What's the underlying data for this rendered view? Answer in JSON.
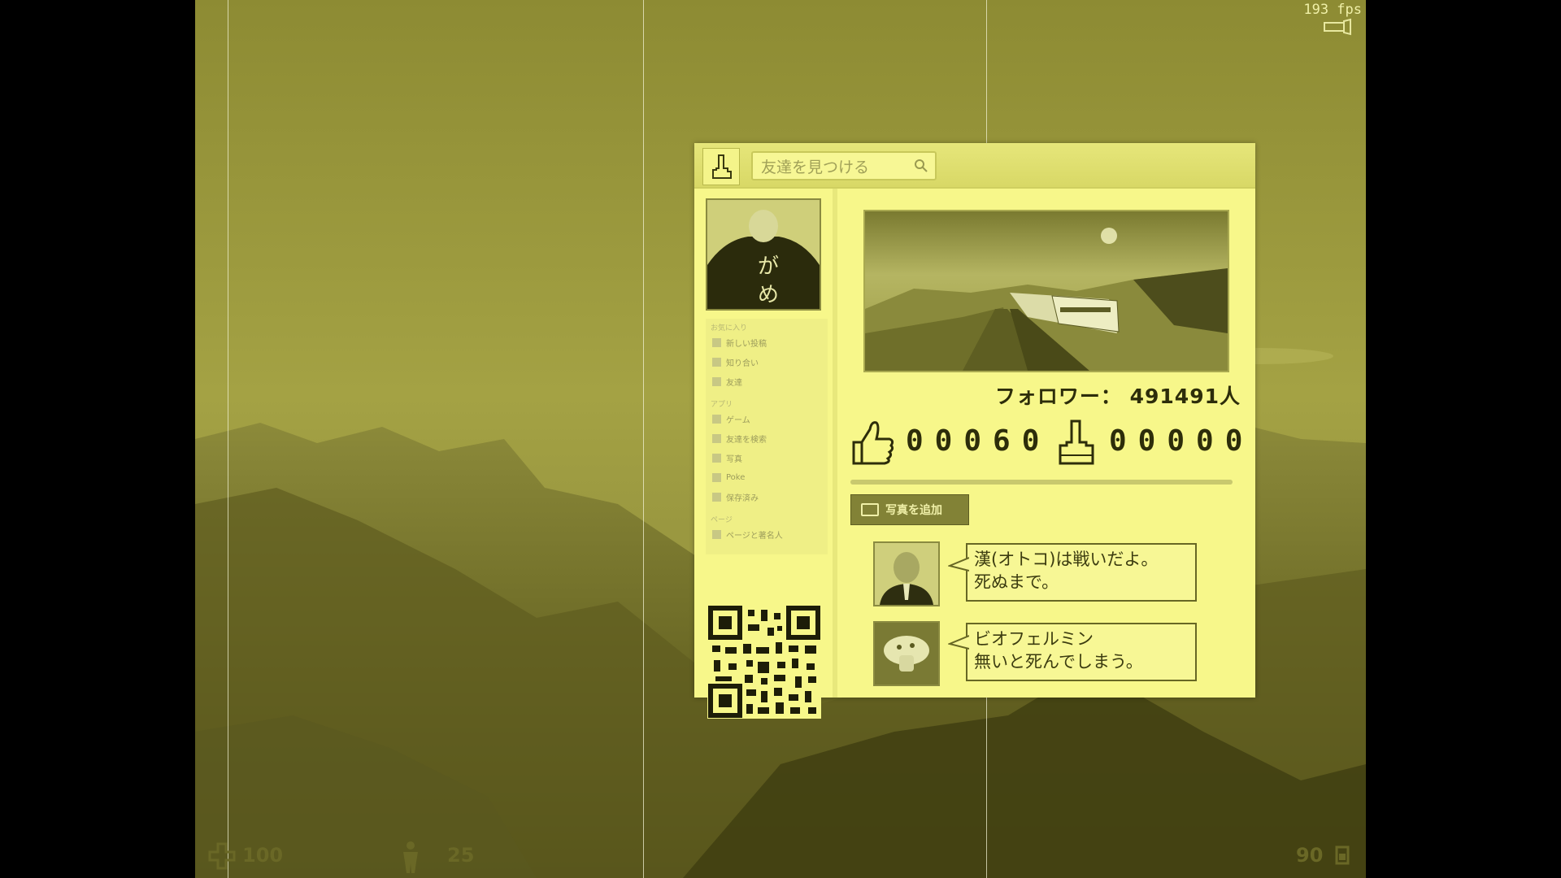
{
  "hud": {
    "fps": "193 fps",
    "health": "100",
    "armor": "25",
    "ammo": "90"
  },
  "panel": {
    "search_placeholder": "友達を見つける",
    "followers": "フォロワー： 491491人",
    "likes": "00060",
    "middle_fingers": "00000",
    "add_photo_label": "写真を追加",
    "menu": {
      "section1": "お気に入り",
      "items1": [
        "新しい投稿",
        "知り合い",
        "友達"
      ],
      "section2": "アプリ",
      "items2": [
        "ゲーム",
        "友達を検索",
        "写真",
        "Poke",
        "保存済み"
      ],
      "section3": "ページ",
      "items3": [
        "ページと著名人"
      ]
    },
    "posts": [
      {
        "line1": "漢(オトコ)は戦いだよ。",
        "line2": "死ぬまで。"
      },
      {
        "line1": "ビオフェルミン",
        "line2": "無いと死んでしまう。"
      }
    ]
  },
  "colors": {
    "tint": "#8f8d35",
    "panel_bg": "#f7f78a",
    "text_dark": "#2d2d0a"
  }
}
